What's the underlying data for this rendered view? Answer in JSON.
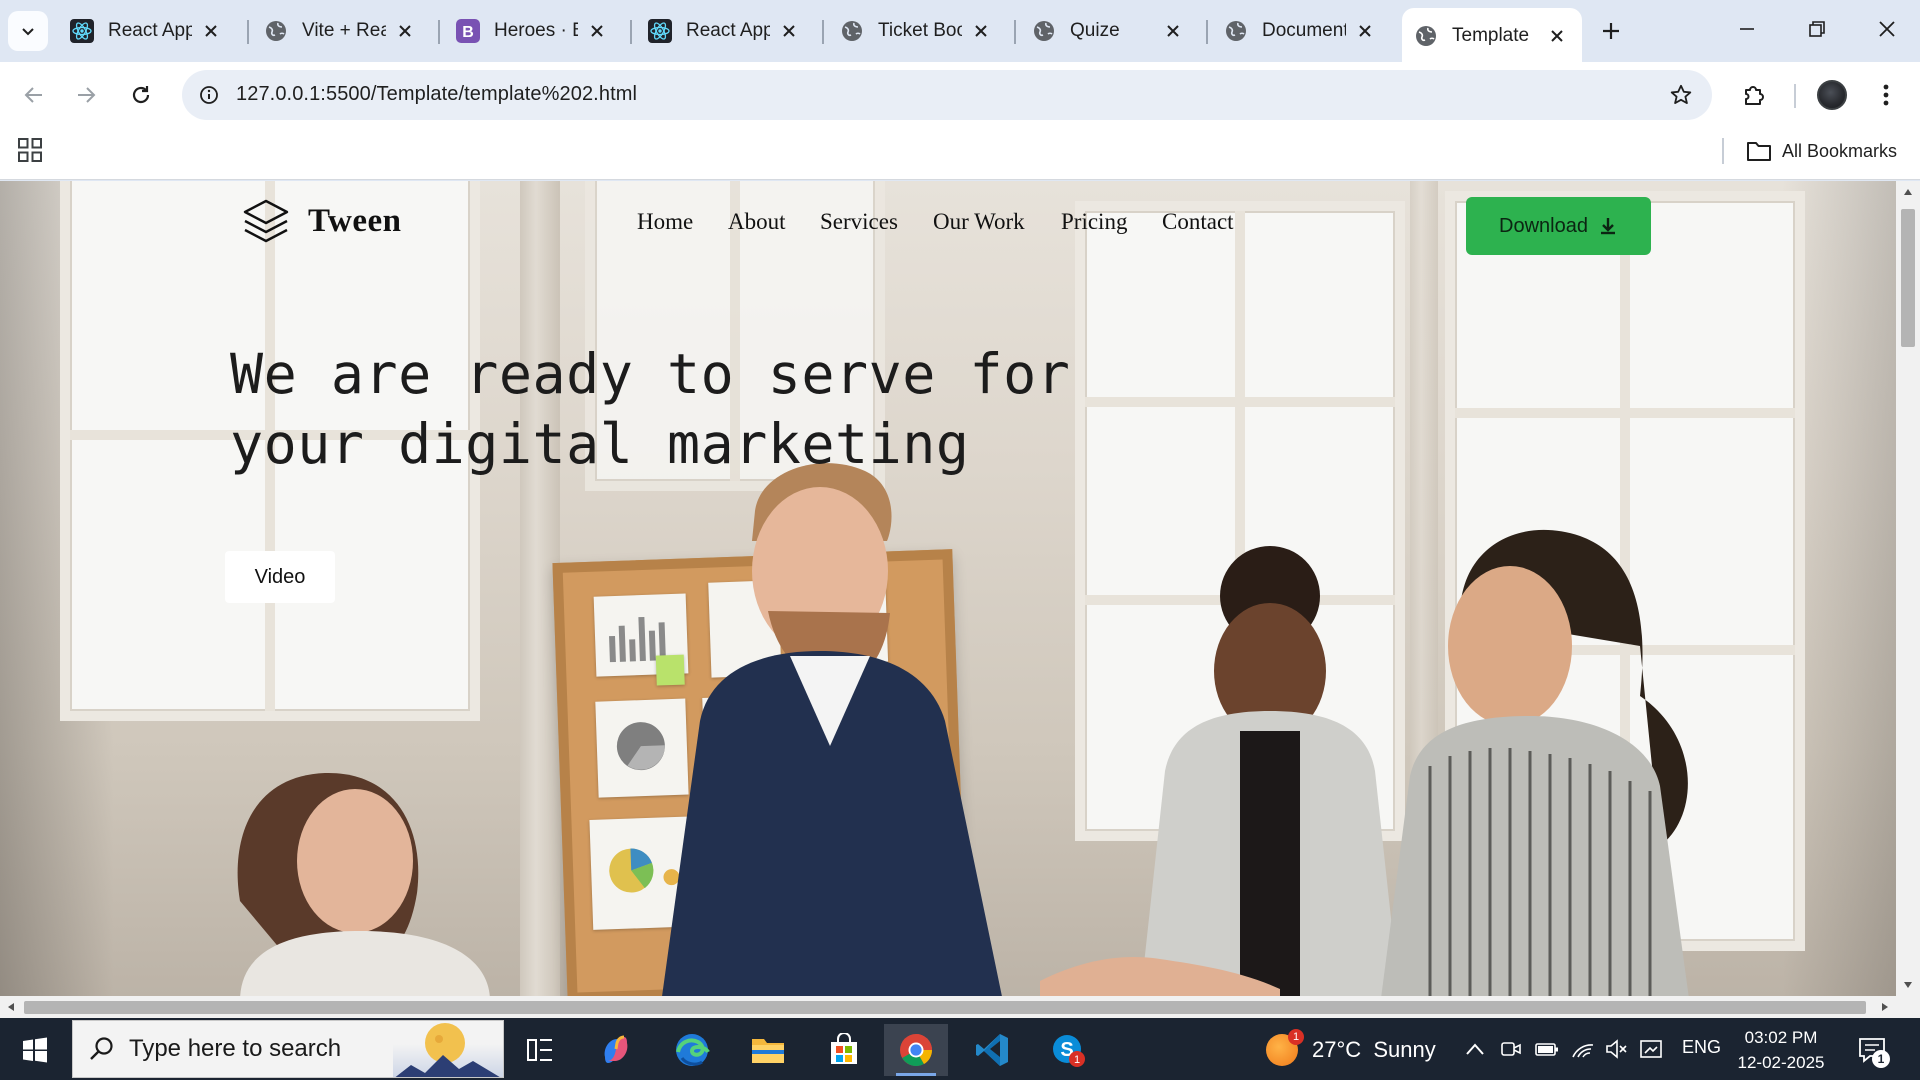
{
  "browser": {
    "tabs": [
      {
        "title": "React App",
        "icon": "react-icon",
        "active": false
      },
      {
        "title": "Vite + React",
        "icon": "globe-icon",
        "active": false
      },
      {
        "title": "Heroes · Bootstrap",
        "icon": "bootstrap-icon",
        "active": false
      },
      {
        "title": "React App",
        "icon": "react-icon",
        "active": false
      },
      {
        "title": "Ticket Booking",
        "icon": "globe-icon",
        "active": false
      },
      {
        "title": "Quize",
        "icon": "globe-icon",
        "active": false
      },
      {
        "title": "Document",
        "icon": "globe-icon",
        "active": false
      },
      {
        "title": "Template",
        "icon": "globe-icon",
        "active": true
      }
    ],
    "url": "127.0.0.1:5500/Template/template%202.html",
    "bookmarks_label": "All Bookmarks",
    "accent": "#dfe7f3"
  },
  "site": {
    "logo": "Tween",
    "nav": [
      "Home",
      "About",
      "Services",
      "Our Work",
      "Pricing",
      "Contact"
    ],
    "download_label": "Download",
    "hero_title": "We are ready to serve for your digital marketing",
    "video_label": "Video",
    "colors": {
      "download": "#2db24f"
    }
  },
  "taskbar": {
    "search_placeholder": "Type here to search",
    "weather": "27°C  Sunny",
    "weather_badge": "1",
    "language": "ENG",
    "time": "03:02 PM",
    "date": "12-02-2025",
    "notification_count": "1",
    "apps": [
      "task-view",
      "copilot",
      "edge",
      "file-explorer",
      "microsoft-store",
      "chrome",
      "vscode",
      "skype"
    ],
    "skype_badge": "1"
  }
}
